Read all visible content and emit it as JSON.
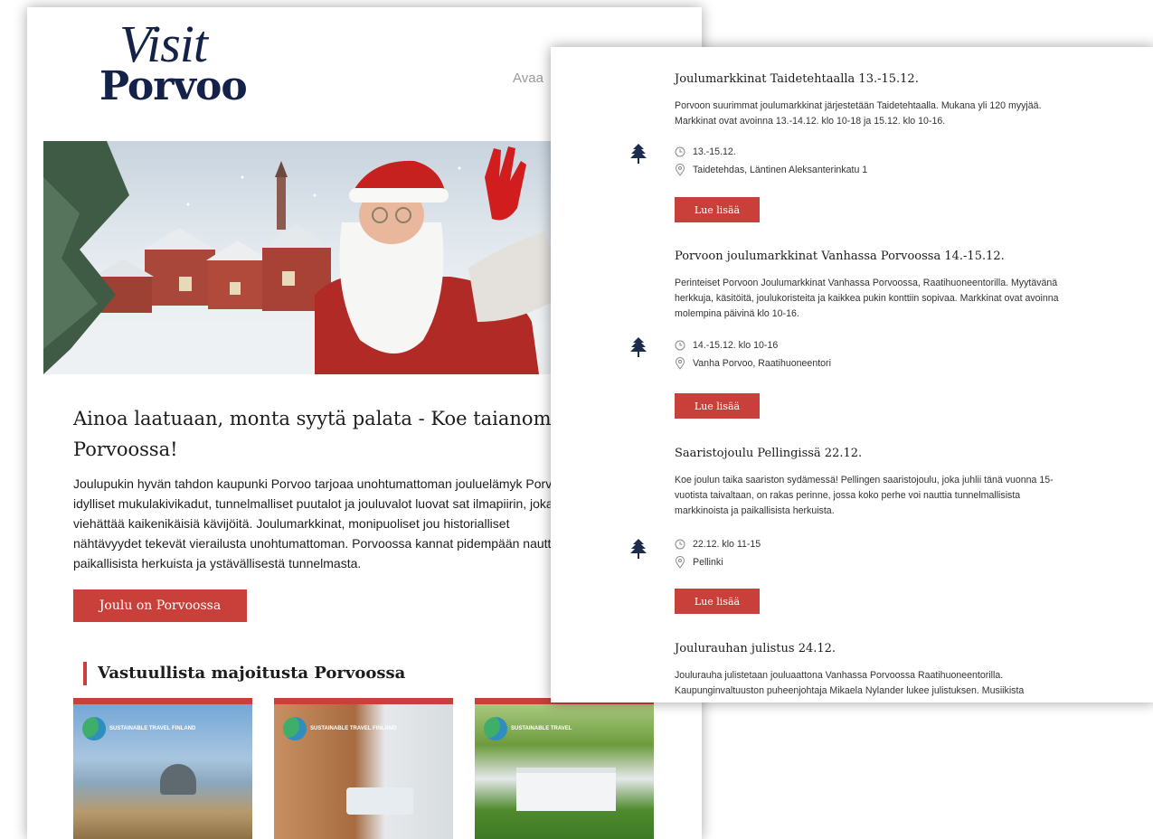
{
  "colors": {
    "accent": "#c9403a",
    "brand_navy": "#14224a"
  },
  "email": {
    "logo": {
      "line1": "Visit",
      "line2": "Porvoo"
    },
    "top_link": "Avaa",
    "headline": "Ainoa laatuaan, monta syytä palata - Koe taianoma Porvoossa!",
    "lead": "Joulupukin hyvän tahdon kaupunki Porvoo tarjoaa unohtumattoman jouluelämyk Porvoon idylliset mukulakivikadut, tunnelmalliset puutalot ja jouluvalot luovat sat ilmapiirin, joka viehättää kaikenikäisiä kävijöitä. Joulumarkkinat, monipuoliset jou historialliset nähtävyydet tekevät vierailusta unohtumattoman. Porvoossa kannat pidempään nauttien paikallisista herkuista ja ystävällisestä tunnelmasta.",
    "cta": "Joulu on Porvoossa",
    "section_title": "Vastuullista majoitusta Porvoossa",
    "cards": [
      {
        "badge": "SUSTAINABLE TRAVEL FINLAND"
      },
      {
        "badge": "SUSTAINABLE TRAVEL FINLAND"
      },
      {
        "badge": "SUSTAINABLE TRAVEL"
      }
    ]
  },
  "events": [
    {
      "title": "Joulumarkkinat Taidetehtaalla 13.-15.12.",
      "description": "Porvoon suurimmat joulumarkkinat järjestetään Taidetehtaalla. Mukana yli 120 myyjää. Markkinat ovat avoinna 13.-14.12. klo 10-18 ja 15.12. klo 10-16.",
      "time": "13.-15.12.",
      "place": "Taidetehdas, Läntinen Aleksanterinkatu 1",
      "button": "Lue lisää",
      "icon": "tree-icon"
    },
    {
      "title": "Porvoon joulumarkkinat Vanhassa Porvoossa 14.-15.12.",
      "description": "Perinteiset Porvoon Joulumarkkinat Vanhassa Porvoossa, Raatihuoneentorilla. Myytävänä herkkuja, käsitöitä, joulukoristeita ja kaikkea pukin konttiin sopivaa. Markkinat ovat avoinna molempina päivinä klo 10-16.",
      "time": "14.-15.12. klo 10-16",
      "place": "Vanha Porvoo, Raatihuoneentori",
      "button": "Lue lisää",
      "icon": "tree-icon"
    },
    {
      "title": "Saaristojoulu Pellingissä 22.12.",
      "description": "Koe joulun taika saariston sydämessä! Pellingen saaristojoulu, joka juhlii tänä vuonna 15-vuotista taivaltaan, on rakas perinne, jossa koko perhe voi nauttia tunnelmallisista markkinoista ja paikallisista herkuista.",
      "time": "22.12. klo 11-15",
      "place": "Pellinki",
      "button": "Lue lisää",
      "icon": "tree-icon"
    },
    {
      "title": "Joulurauhan julistus 24.12.",
      "description": "Joulurauha julistetaan jouluaattona Vanhassa Porvoossa Raatihuoneentorilla. Kaupunginvaltuuston puheenjohtaja Mikaela Nylander lukee julistuksen. Musiikista"
    }
  ]
}
